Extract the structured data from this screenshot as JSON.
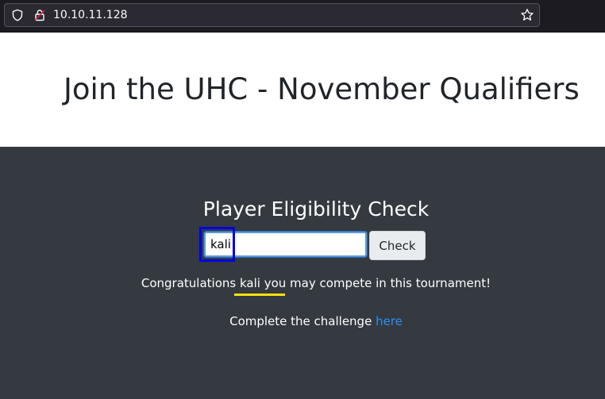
{
  "browser": {
    "url": "10.10.11.128",
    "icons": [
      "shield-icon",
      "lock-icon",
      "star-icon"
    ]
  },
  "header": {
    "title": "Join the UHC - November Qualifiers"
  },
  "main": {
    "heading": "Player Eligibility Check",
    "input_value": "kali",
    "check_label": "Check",
    "result_prefix": "Congratulations ",
    "result_name": "kali",
    "result_suffix": " you may compete in this tournament!",
    "challenge_prefix": "Complete the challenge ",
    "challenge_link": "here"
  },
  "colors": {
    "header_bg": "#ffffff",
    "main_bg": "#343a40",
    "link": "#2f8cf5",
    "highlight_box": "#0000e6",
    "underline_mark": "#f5e20f"
  }
}
